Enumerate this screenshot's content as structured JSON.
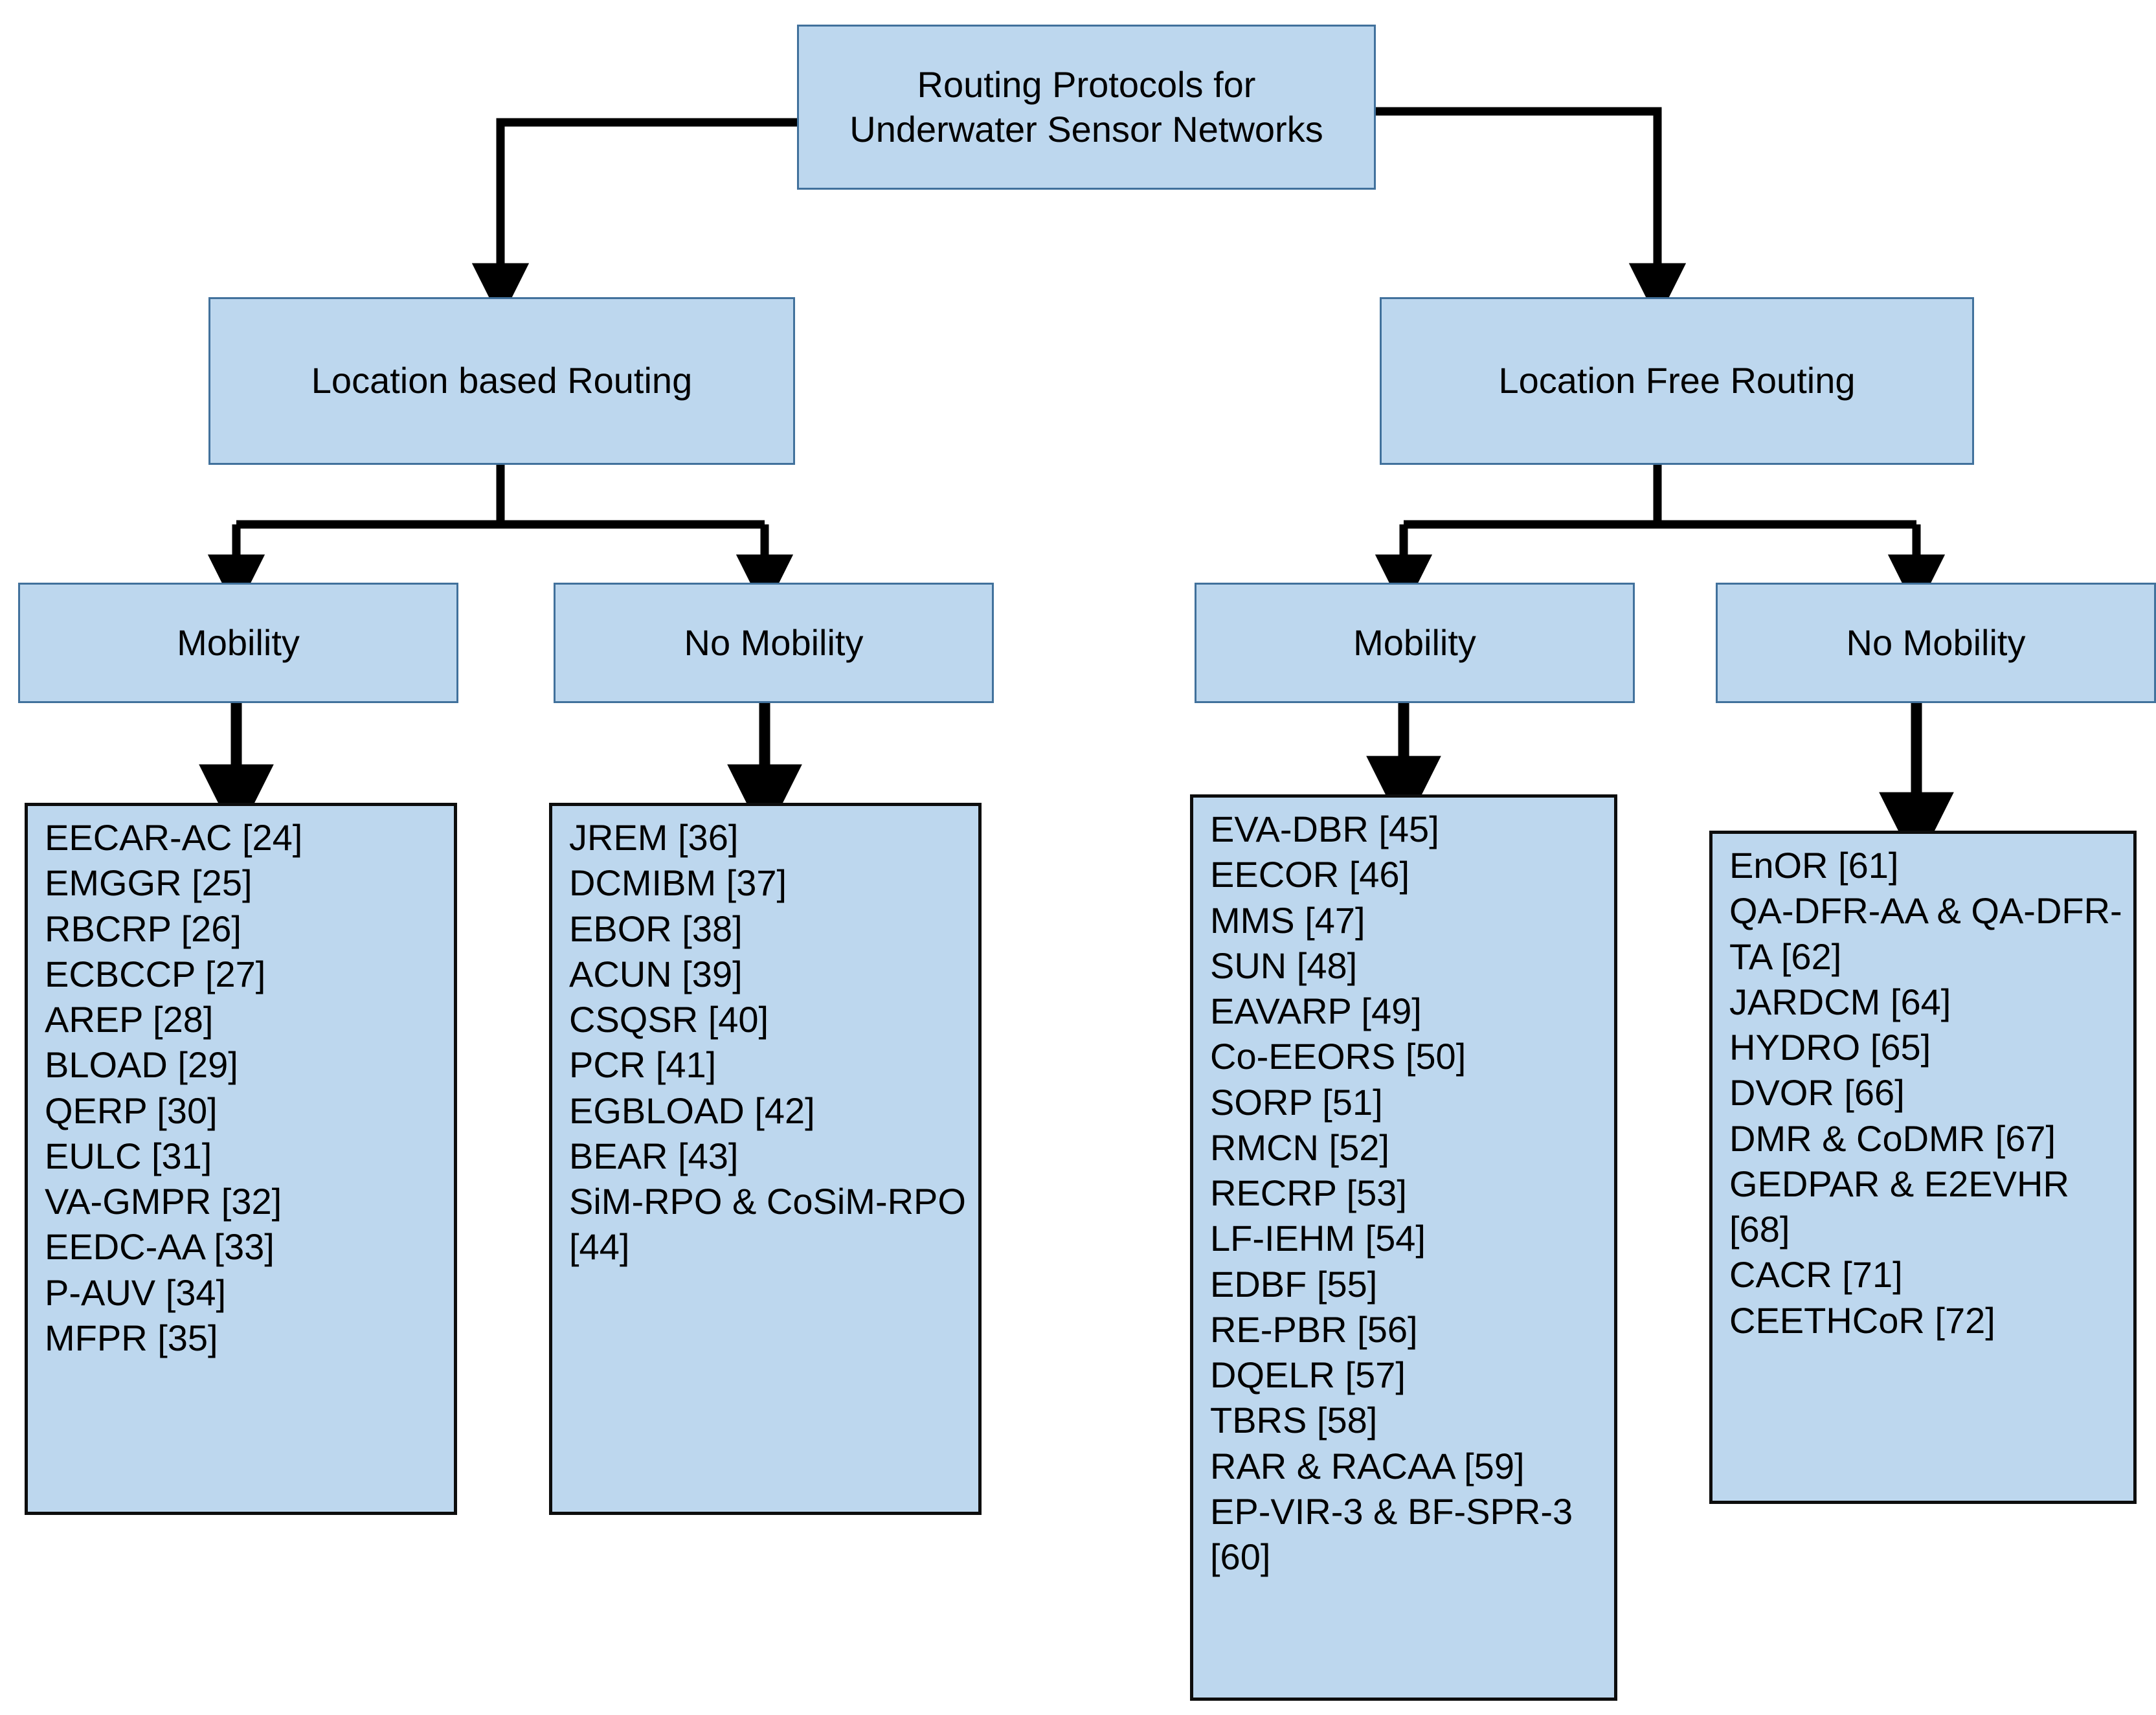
{
  "diagram": {
    "type": "hierarchy-tree",
    "title": "Routing Protocols for Underwater Sensor Networks taxonomy",
    "colors": {
      "node_fill": "#BDD7EE",
      "top_node_border": "#41719C",
      "leaf_node_border": "#0D0D0D",
      "connector": "#000000",
      "text": "#000000",
      "background": "#FFFFFF"
    },
    "root": {
      "label": "Routing Protocols for\nUnderwater Sensor Networks"
    },
    "branches": [
      {
        "label": "Location based Routing",
        "children": [
          {
            "label": "Mobility",
            "items": [
              "EECAR-AC [24]",
              "EMGGR [25]",
              "RBCRP [26]",
              "ECBCCP [27]",
              "AREP [28]",
              "BLOAD [29]",
              "QERP [30]",
              "EULC [31]",
              "VA-GMPR [32]",
              "EEDC-AA [33]",
              "P-AUV [34]",
              "MFPR [35]"
            ]
          },
          {
            "label": "No Mobility",
            "items": [
              "JREM [36]",
              "DCMIBM [37]",
              "EBOR [38]",
              "ACUN [39]",
              "CSQSR [40]",
              "PCR [41]",
              "EGBLOAD [42]",
              "BEAR [43]",
              "SiM-RPO & CoSiM-RPO [44]"
            ]
          }
        ]
      },
      {
        "label": "Location Free Routing",
        "children": [
          {
            "label": "Mobility",
            "items": [
              "EVA-DBR [45]",
              "EECOR [46]",
              "MMS [47]",
              "SUN [48]",
              "EAVARP [49]",
              "Co-EEORS [50]",
              "SORP [51]",
              "RMCN [52]",
              "RECRP [53]",
              "LF-IEHM [54]",
              "EDBF [55]",
              "RE-PBR [56]",
              "DQELR [57]",
              "TBRS [58]",
              "RAR & RACAA [59]",
              "EP-VIR-3 & BF-SPR-3 [60]"
            ]
          },
          {
            "label": "No Mobility",
            "items": [
              "EnOR [61]",
              "QA-DFR-AA & QA-DFR-TA [62]",
              "JARDCM [64]",
              "HYDRO [65]",
              "DVOR [66]",
              "DMR & CoDMR [67]",
              "GEDPAR & E2EVHR [68]",
              "CACR [71]",
              "CEETHCoR [72]"
            ]
          }
        ]
      }
    ]
  }
}
